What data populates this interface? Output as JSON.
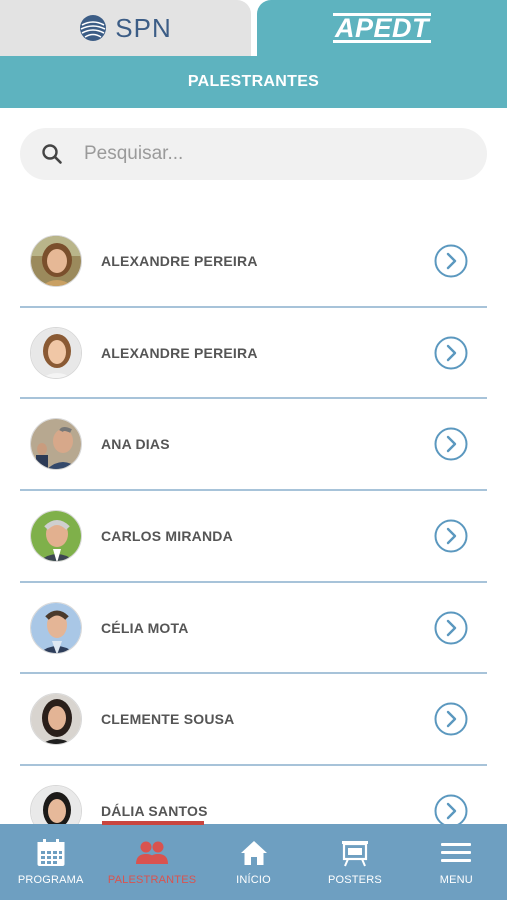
{
  "org_tabs": [
    {
      "label": "SPN",
      "active": false
    },
    {
      "label": "APEDT",
      "active": true
    }
  ],
  "header": {
    "title": "PALESTRANTES"
  },
  "search": {
    "placeholder": "Pesquisar...",
    "value": ""
  },
  "speakers": [
    {
      "name": "ALEXANDRE PEREIRA"
    },
    {
      "name": "ALEXANDRE PEREIRA"
    },
    {
      "name": "ANA DIAS"
    },
    {
      "name": "CARLOS MIRANDA"
    },
    {
      "name": "CÉLIA MOTA"
    },
    {
      "name": "CLEMENTE SOUSA"
    },
    {
      "name": "DÁLIA SANTOS"
    }
  ],
  "bottom_nav": [
    {
      "label": "PROGRAMA",
      "icon": "calendar-icon",
      "active": false
    },
    {
      "label": "PALESTRANTES",
      "icon": "people-icon",
      "active": true
    },
    {
      "label": "INÍCIO",
      "icon": "home-icon",
      "active": false
    },
    {
      "label": "POSTERS",
      "icon": "presentation-board-icon",
      "active": false
    },
    {
      "label": "MENU",
      "icon": "hamburger-icon",
      "active": false
    }
  ],
  "colors": {
    "teal": "#5eb3bf",
    "nav_blue": "#6e9fc1",
    "active_red": "#d9534f",
    "divider": "#a7c3d9",
    "chevron": "#5b98bf"
  }
}
